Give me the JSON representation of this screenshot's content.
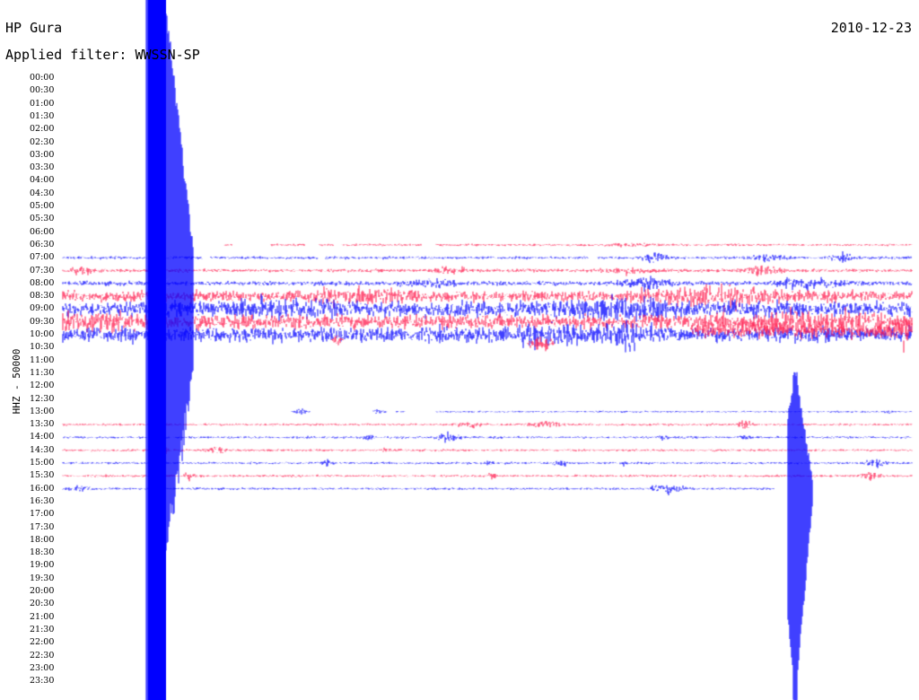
{
  "header": {
    "station": "HP Gura",
    "filter": "Applied filter: WWSSN-SP",
    "date": "2010-12-23"
  },
  "channel_label": "HHZ - 50000",
  "time_labels": [
    "00:00",
    "00:30",
    "01:00",
    "01:30",
    "02:00",
    "02:30",
    "03:00",
    "03:30",
    "04:00",
    "04:30",
    "05:00",
    "05:30",
    "06:00",
    "06:30",
    "07:00",
    "07:30",
    "08:00",
    "08:30",
    "09:00",
    "09:30",
    "10:00",
    "10:30",
    "11:00",
    "11:30",
    "12:00",
    "12:30",
    "13:00",
    "13:30",
    "14:00",
    "14:30",
    "15:00",
    "15:30",
    "16:00",
    "16:30",
    "17:00",
    "17:30",
    "18:00",
    "18:30",
    "19:00",
    "19:30",
    "20:00",
    "20:30",
    "21:00",
    "21:30",
    "22:00",
    "22:30",
    "23:00",
    "23:30"
  ],
  "colors": {
    "trace_a": "#0000ff",
    "trace_b": "#ff1a4d",
    "background": "#ffffff",
    "text": "#000000"
  },
  "chart_data": {
    "type": "seismogram",
    "title": "HP Gura",
    "subtitle": "Applied filter: WWSSN-SP",
    "date": "2010-12-23",
    "ylabel": "HHZ - 50000",
    "row_interval_minutes": 30,
    "rows_with_data": [
      "06:30",
      "07:00",
      "07:30",
      "08:00",
      "08:30",
      "09:00",
      "09:30",
      "10:00",
      "10:30",
      "13:00",
      "13:30",
      "14:00",
      "14:30",
      "15:00",
      "15:30",
      "16:00"
    ],
    "alternating_colors": [
      "blue",
      "red"
    ],
    "notable_events": [
      {
        "type": "large earthquake",
        "near": "start of 06:30–16:00 block",
        "amplitude": "spans full plot"
      },
      {
        "type": "local event",
        "near": "16:00",
        "amplitude": "large"
      }
    ]
  }
}
